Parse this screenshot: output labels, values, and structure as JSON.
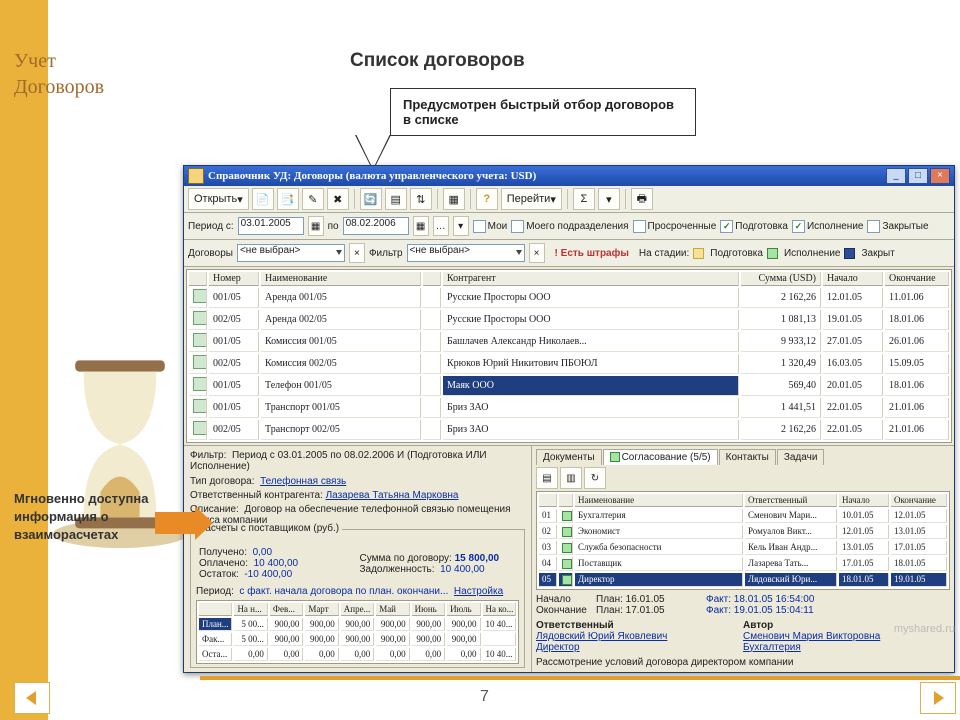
{
  "slide": {
    "brand1": "Учет",
    "brand2": "Договоров",
    "title": "Список договоров",
    "callout_top": "Предусмотрен быстрый отбор договоров в списке",
    "annot_left": "Мгновенно доступна информация о взаиморасчетах",
    "page": "7",
    "watermark": "myshared.ru"
  },
  "win": {
    "title": "Справочник УД: Договоры (валюта управленческого учета: USD)",
    "open": "Открыть",
    "goto": "Перейти",
    "period_lbl": "Период с:",
    "to_lbl": "по",
    "from": "03.01.2005",
    "to": "08.02.2006",
    "f_mine": "Мои",
    "f_dept": "Моего подразделения",
    "f_over": "Просроченные",
    "f_prep": "Подготовка",
    "f_exec": "Исполнение",
    "f_closed": "Закрытые",
    "contracts_lbl": "Договоры",
    "not_selected": "<не выбран>",
    "filter_lbl": "Фильтр",
    "fine_msg": "Есть штрафы",
    "stage_lbl": "На стадии:",
    "st_prep": "Подготовка",
    "st_exec": "Исполнение",
    "st_closed": "Закрыт"
  },
  "cols": {
    "num": "Номер",
    "name": "Наименование",
    "cp": "Контрагент",
    "sum": "Сумма (USD)",
    "start": "Начало",
    "end": "Окончание"
  },
  "rows": [
    {
      "n": "001/05",
      "name": "Аренда 001/05",
      "cp": "Русские Просторы ООО",
      "sum": "2 162,26",
      "st": "12.01.05",
      "en": "11.01.06"
    },
    {
      "n": "002/05",
      "name": "Аренда 002/05",
      "cp": "Русские Просторы ООО",
      "sum": "1 081,13",
      "st": "19.01.05",
      "en": "18.01.06"
    },
    {
      "n": "001/05",
      "name": "Комиссия 001/05",
      "cp": "Башлачев Александр Николаев...",
      "sum": "9 933,12",
      "st": "27.01.05",
      "en": "26.01.06"
    },
    {
      "n": "002/05",
      "name": "Комиссия 002/05",
      "cp": "Крюков Юрий Никитович ПБОЮЛ",
      "sum": "1 320,49",
      "st": "16.03.05",
      "en": "15.09.05"
    },
    {
      "n": "001/05",
      "name": "Телефон 001/05",
      "cp": "Маяк ООО",
      "sum": "569,40",
      "st": "20.01.05",
      "en": "18.01.06",
      "sel": true
    },
    {
      "n": "001/05",
      "name": "Транспорт 001/05",
      "cp": "Бриз ЗАО",
      "sum": "1 441,51",
      "st": "22.01.05",
      "en": "21.01.06"
    },
    {
      "n": "002/05",
      "name": "Транспорт 002/05",
      "cp": "Бриз ЗАО",
      "sum": "2 162,26",
      "st": "22.01.05",
      "en": "21.01.06"
    }
  ],
  "det": {
    "filter_lbl": "Фильтр:",
    "filter_val": "Период с 03.01.2005 по 08.02.2006 И (Подготовка ИЛИ Исполнение)",
    "type_lbl": "Тип договора:",
    "type_val": "Телефонная связь",
    "resp_lbl": "Ответственный контрагента:",
    "resp_val": "Лазарева Татьяна Марковна",
    "desc_lbl": "Описание:",
    "desc_val": "Договор на обеспечение телефонной связью помещения офиса компании",
    "calc_title": "Расчеты с поставщиком (руб.)",
    "recv_lbl": "Получено:",
    "recv_val": "0,00",
    "paid_lbl": "Оплачено:",
    "paid_val": "10 400,00",
    "bal_lbl": "Остаток:",
    "bal_val": "-10 400,00",
    "per_lbl": "Период:",
    "per_val": "с факт. начала договора по план. окончани...",
    "tune": "Настройка",
    "csum_lbl": "Сумма по договору:",
    "csum_val": "15 800,00",
    "debt_lbl": "Задолженность:",
    "debt_val": "10 400,00",
    "months": [
      "На н...",
      "Фев...",
      "Март",
      "Апре...",
      "Май",
      "Июнь",
      "Июль",
      "На ко..."
    ],
    "mrows": [
      {
        "l": "План...",
        "v": [
          "5 00...",
          "900,00",
          "900,00",
          "900,00",
          "900,00",
          "900,00",
          "900,00",
          "10 40..."
        ]
      },
      {
        "l": "Фак...",
        "v": [
          "5 00...",
          "900,00",
          "900,00",
          "900,00",
          "900,00",
          "900,00",
          "900,00",
          ""
        ]
      },
      {
        "l": "Оста...",
        "v": [
          "0,00",
          "0,00",
          "0,00",
          "0,00",
          "0,00",
          "0,00",
          "0,00",
          "10 40..."
        ]
      }
    ]
  },
  "tabs": {
    "docs": "Документы",
    "appr": "Согласование (5/5)",
    "cont": "Контакты",
    "tasks": "Задачи"
  },
  "appr": {
    "cols": {
      "n": "Наименование",
      "r": "Ответственный",
      "s": "Начало",
      "e": "Окончание"
    },
    "rows": [
      {
        "i": "01",
        "n": "Бухгалтерия",
        "r": "Сменович Мари...",
        "s": "10.01.05",
        "e": "12.01.05"
      },
      {
        "i": "02",
        "n": "Экономист",
        "r": "Ромуалов Викт...",
        "s": "12.01.05",
        "e": "13.01.05"
      },
      {
        "i": "03",
        "n": "Служба безопасности",
        "r": "Кель Иван Андр...",
        "s": "13.01.05",
        "e": "17.01.05"
      },
      {
        "i": "04",
        "n": "Поставщик",
        "r": "Лазарева Тать...",
        "s": "17.01.05",
        "e": "18.01.05"
      },
      {
        "i": "05",
        "n": "Директор",
        "r": "Лядовский Юри...",
        "s": "18.01.05",
        "e": "19.01.05",
        "sel": true
      }
    ],
    "start_lbl": "Начало",
    "end_lbl": "Окончание",
    "plan_s": "План: 16.01.05",
    "fact_s": "Факт: 18.01.05 16:54:00",
    "plan_e": "План: 17.01.05",
    "fact_e": "Факт: 19.01.05 15:04:11",
    "resp_lbl": "Ответственный",
    "auth_lbl": "Автор",
    "resp1": "Лядовский Юрий Яковлевич",
    "resp2": "Директор",
    "auth1": "Сменович Мария Викторовна",
    "auth2": "Бухгалтерия",
    "note": "Рассмотрение условий договора директором компании"
  }
}
